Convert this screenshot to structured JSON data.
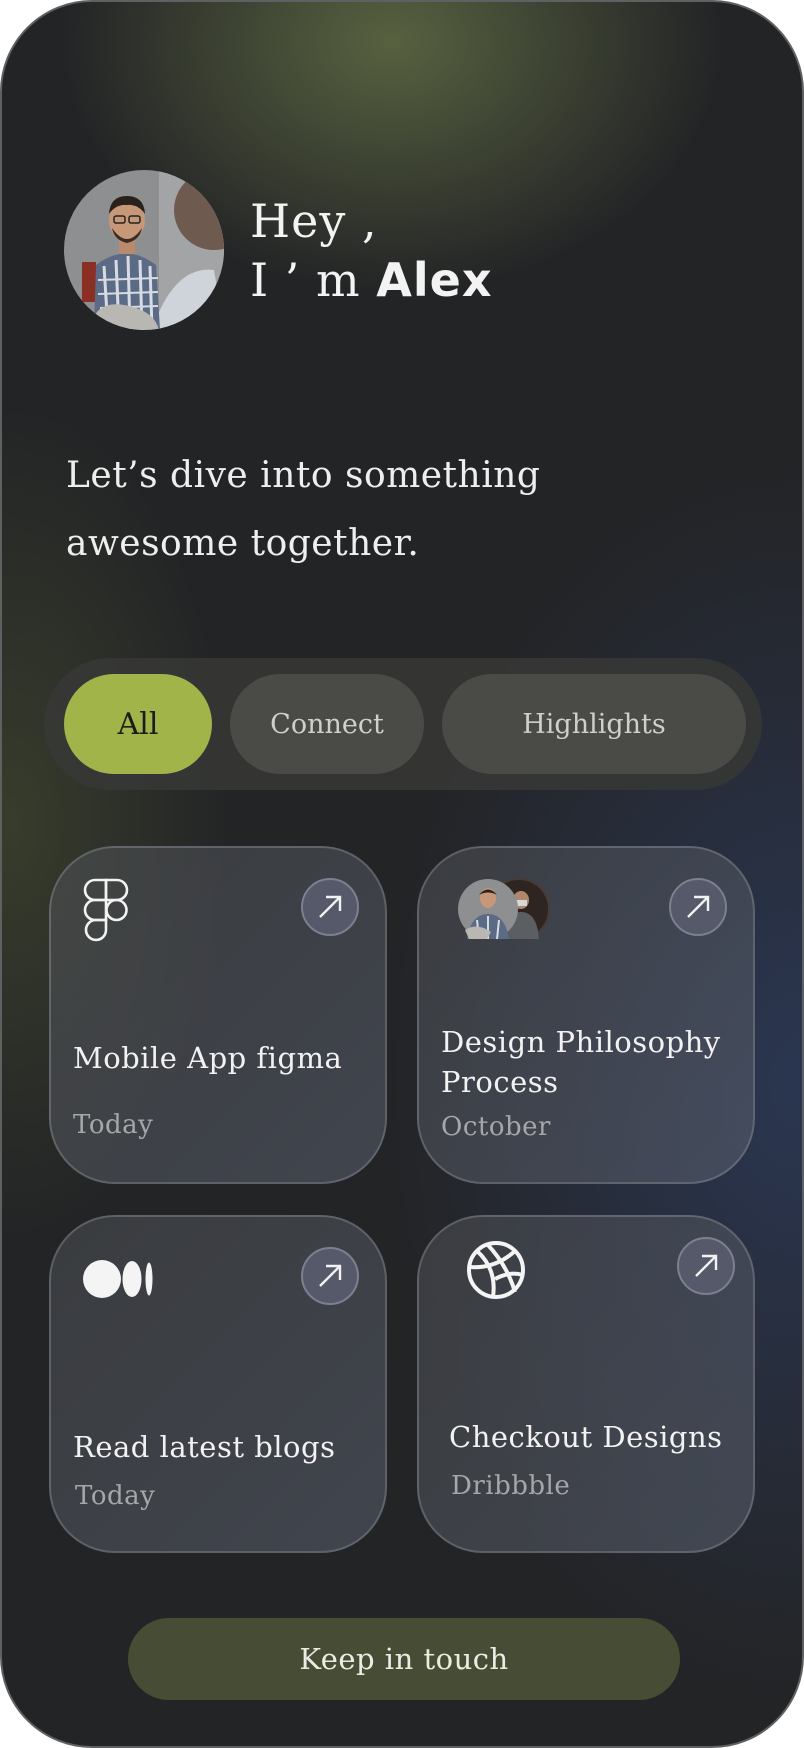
{
  "profile": {
    "greeting_line1": "Hey ,",
    "greeting_prefix": "I ’ m",
    "name": "Alex"
  },
  "tagline": "Let’s dive into something awesome together.",
  "filters": [
    {
      "label": "All",
      "active": true
    },
    {
      "label": "Connect",
      "active": false
    },
    {
      "label": "Highlights",
      "active": false
    }
  ],
  "cards": [
    {
      "title": "Mobile App figma",
      "subtitle": "Today",
      "icon": "figma-icon"
    },
    {
      "title": "Design Philosophy Process",
      "subtitle": "October",
      "icon": "people-avatars"
    },
    {
      "title": "Read latest blogs",
      "subtitle": "Today",
      "icon": "medium-icon"
    },
    {
      "title": "Checkout Designs",
      "subtitle": "Dribbble",
      "icon": "dribbble-icon"
    }
  ],
  "cta_label": "Keep in touch",
  "colors": {
    "accent": "#a0b44a",
    "background": "#232426",
    "cta": "#474d35"
  }
}
